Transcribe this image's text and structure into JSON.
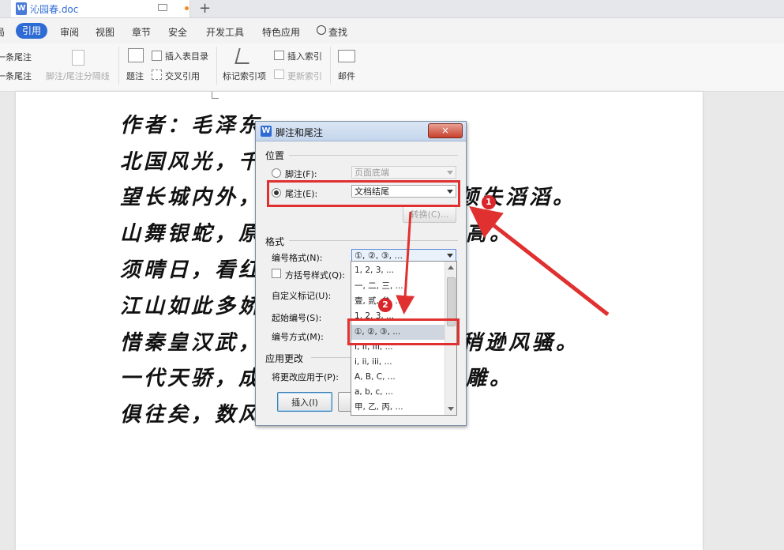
{
  "tabbar": {
    "doc_icon": "W",
    "doc_name": "沁园春.doc",
    "new_tab": "+"
  },
  "menu": {
    "items": [
      "局",
      "引用",
      "审阅",
      "视图",
      "章节",
      "安全",
      "开发工具",
      "特色应用",
      "查找"
    ],
    "active_index": 1
  },
  "ribbon": {
    "prev_footnote": "一条尾注",
    "next_footnote": "一条尾注",
    "separator_label": "脚注/尾注分隔线",
    "caption": "题注",
    "insert_toc": "插入表目录",
    "cross_ref": "交叉引用",
    "mark_index": "标记索引项",
    "insert_index": "插入索引",
    "update_index": "更新索引",
    "mail": "邮件"
  },
  "document": {
    "lines": [
      "作者：毛泽东",
      "北国风光，千里",
      "望长城内外，惟",
      "山舞银蛇，原驰",
      "须晴日，看红装",
      "江山如此多娇，",
      "惜秦皇汉武，略",
      "一代天骄，成吉",
      "俱往矣，数风流"
    ],
    "right_fragments": [
      {
        "text": "顿失滔滔。"
      },
      {
        "text": "高。"
      },
      {
        "text": "稍逊风骚。"
      },
      {
        "text": "雕。"
      }
    ]
  },
  "dialog": {
    "logo": "W",
    "title": "脚注和尾注",
    "close": "×",
    "position_section": "位置",
    "footnote_label": "脚注(F):",
    "footnote_value": "页面底端",
    "endnote_label": "尾注(E):",
    "endnote_value": "文档结尾",
    "endnote_selected": true,
    "convert_button": "转换(C)...",
    "format_section": "格式",
    "number_format_label": "编号格式(N):",
    "number_format_value": "①, ②, ③, ...",
    "bracket_label": "方括号样式(Q):",
    "custom_mark_label": "自定义标记(U):",
    "start_number_label": "起始编号(S):",
    "numbering_label": "编号方式(M):",
    "apply_section": "应用更改",
    "apply_to_label": "将更改应用于(P):",
    "insert_button": "插入(I)"
  },
  "dropdown": {
    "options": [
      "1, 2, 3, ...",
      "一, 二, 三, ...",
      "壹, 贰, 叁, ...",
      "1, 2, 3, ...",
      "①, ②, ③, ...",
      "I, II, III, ...",
      "i, ii, iii, ...",
      "A, B, C, ...",
      "a, b, c, ...",
      "甲, 乙, 丙, ..."
    ],
    "selected_index": 4
  },
  "annotations": {
    "badge1": "1",
    "badge2": "2",
    "color": "#e03030"
  }
}
